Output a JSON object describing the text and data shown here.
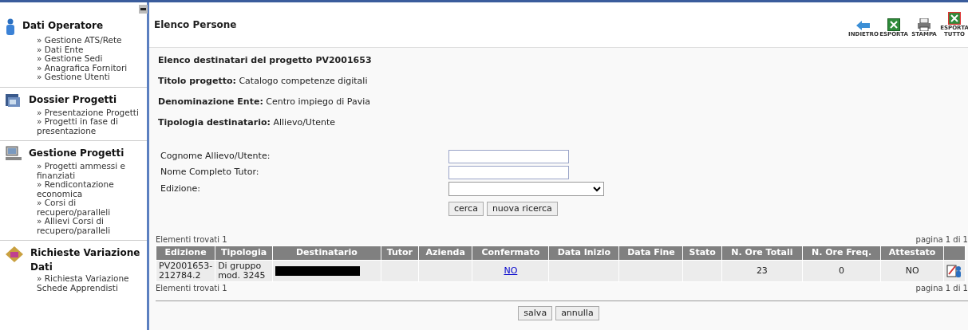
{
  "sidebar": {
    "sections": [
      {
        "kind": "operator",
        "title": "Dati Operatore",
        "links": [
          "» Gestione ATS/Rete",
          "» Dati Ente",
          "» Gestione Sedi",
          "» Anagrafica Fornitori",
          "» Gestione Utenti"
        ]
      },
      {
        "kind": "dossier",
        "title": "Dossier Progetti",
        "links": [
          "» Presentazione Progetti",
          "» Progetti in fase di presentazione"
        ]
      },
      {
        "kind": "manage",
        "title": "Gestione Progetti",
        "links": [
          "» Progetti ammessi e finanziati",
          "» Rendicontazione economica",
          "» Corsi di recupero/paralleli",
          "» Allievi Corsi di recupero/paralleli"
        ]
      },
      {
        "kind": "change",
        "title": "Richieste Variazione Dati",
        "links": [
          "» Richiesta Variazione Schede Apprendisti"
        ]
      }
    ]
  },
  "header": {
    "title": "Elenco Persone",
    "tools": [
      {
        "kind": "back",
        "label": "INDIETRO"
      },
      {
        "kind": "excel",
        "label": "ESPORTA"
      },
      {
        "kind": "print",
        "label": "STAMPA"
      },
      {
        "kind": "excel-all",
        "label": "ESPORTA TUTTO"
      }
    ]
  },
  "info": {
    "heading": "Elenco destinatari del progetto PV2001653",
    "fields": [
      {
        "label": "Titolo progetto:",
        "value": "Catalogo competenze digitali"
      },
      {
        "label": "Denominazione Ente:",
        "value": "Centro impiego di Pavia"
      },
      {
        "label": "Tipologia destinatario:",
        "value": "Allievo/Utente"
      }
    ]
  },
  "search": {
    "fields": [
      {
        "kind": "text",
        "label": "Cognome Allievo/Utente:"
      },
      {
        "kind": "text",
        "label": "Nome Completo Tutor:"
      },
      {
        "kind": "select",
        "label": "Edizione:"
      }
    ],
    "buttons": [
      "cerca",
      "nuova ricerca"
    ]
  },
  "table": {
    "count_top": "Elementi trovati 1",
    "page_top": "pagina 1 di 1",
    "count_bottom": "Elementi trovati 1",
    "page_bottom": "pagina 1 di 1",
    "columns": [
      "Edizione",
      "Tipologia",
      "Destinatario",
      "Tutor",
      "Azienda",
      "Confermato",
      "Data Inizio",
      "Data Fine",
      "Stato",
      "N. Ore Totali",
      "N. Ore Freq.",
      "Attestato"
    ],
    "rows": [
      {
        "cells": [
          {
            "kind": "text",
            "text": "PV2001653-212784.2"
          },
          {
            "kind": "text",
            "text": "Di gruppo mod. 3245"
          },
          {
            "kind": "redacted"
          },
          {
            "kind": "empty"
          },
          {
            "kind": "empty"
          },
          {
            "kind": "link",
            "text": "NO"
          },
          {
            "kind": "empty"
          },
          {
            "kind": "empty"
          },
          {
            "kind": "empty"
          },
          {
            "kind": "number",
            "text": "23"
          },
          {
            "kind": "number",
            "text": "0"
          },
          {
            "kind": "number",
            "text": "NO"
          },
          {
            "kind": "edit-icon"
          }
        ]
      }
    ]
  },
  "actions": [
    "salva",
    "annulla"
  ]
}
